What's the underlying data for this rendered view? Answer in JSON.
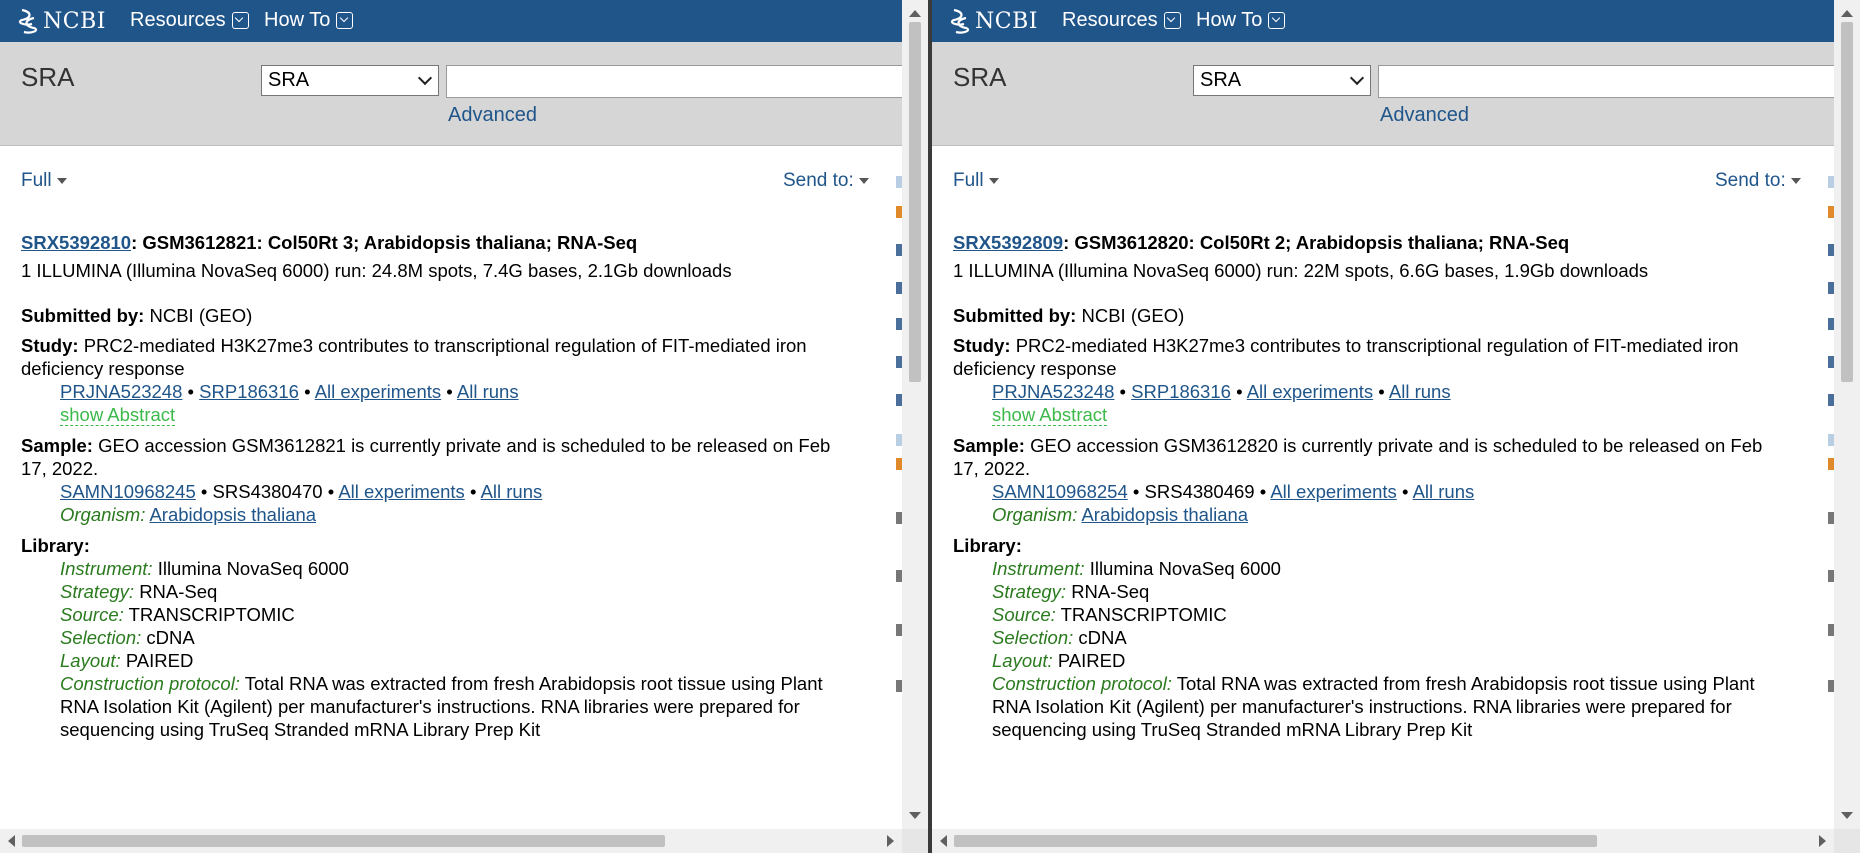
{
  "header": {
    "logo_text": "NCBI",
    "resources_label": "Resources",
    "howto_label": "How To"
  },
  "search": {
    "db_title": "SRA",
    "db_selected": "SRA",
    "input_value": "",
    "advanced_label": "Advanced"
  },
  "toolbar": {
    "format_label": "Full",
    "send_to_label": "Send to:"
  },
  "colors": {
    "header_bg": "#20558a",
    "search_bg": "#d6d6d6",
    "link": "#20558a",
    "field_label_green": "#2a7a1e",
    "show_abstract_green": "#3cb94a"
  },
  "records": [
    {
      "accession": "SRX5392810",
      "title_rest": ": GSM3612821: Col50Rt 3; Arabidopsis thaliana; RNA-Seq",
      "run_line": "1 ILLUMINA (Illumina NovaSeq 6000) run: 24.8M spots, 7.4G bases, 2.1Gb downloads",
      "submitted_label": "Submitted by:",
      "submitted_value": "NCBI (GEO)",
      "study_label": "Study:",
      "study_line1": "PRC2-mediated H3K27me3 contributes to transcriptional regulation of FIT-mediated iron",
      "study_line2": "deficiency response",
      "study_links": {
        "bioproject": "PRJNA523248",
        "srp": "SRP186316",
        "all_experiments": "All experiments",
        "all_runs": "All runs",
        "sep": "•"
      },
      "show_abstract": "show Abstract",
      "sample_label": "Sample:",
      "sample_line1": "GEO accession GSM3612821 is currently private and is scheduled to be released on Feb",
      "sample_line2": "17, 2022.",
      "sample_links": {
        "biosample": "SAMN10968245",
        "srs": "SRS4380470",
        "all_experiments": "All experiments",
        "all_runs": "All runs",
        "sep": "•"
      },
      "organism_label": "Organism:",
      "organism_value": "Arabidopsis thaliana",
      "library_label": "Library:",
      "instrument_label": "Instrument:",
      "instrument_value": "Illumina NovaSeq 6000",
      "strategy_label": "Strategy:",
      "strategy_value": "RNA-Seq",
      "source_label": "Source:",
      "source_value": "TRANSCRIPTOMIC",
      "selection_label": "Selection:",
      "selection_value": "cDNA",
      "layout_label": "Layout:",
      "layout_value": "PAIRED",
      "protocol_label": "Construction protocol:",
      "protocol_line1": "Total RNA was extracted from fresh Arabidopsis root tissue using Plant",
      "protocol_line2": "RNA Isolation Kit (Agilent) per manufacturer's instructions. RNA libraries were prepared for",
      "protocol_line3": "sequencing using TruSeq Stranded mRNA Library Prep Kit"
    },
    {
      "accession": "SRX5392809",
      "title_rest": ": GSM3612820: Col50Rt 2; Arabidopsis thaliana; RNA-Seq",
      "run_line": "1 ILLUMINA (Illumina NovaSeq 6000) run: 22M spots, 6.6G bases, 1.9Gb downloads",
      "submitted_label": "Submitted by:",
      "submitted_value": "NCBI (GEO)",
      "study_label": "Study:",
      "study_line1": "PRC2-mediated H3K27me3 contributes to transcriptional regulation of FIT-mediated iron",
      "study_line2": "deficiency response",
      "study_links": {
        "bioproject": "PRJNA523248",
        "srp": "SRP186316",
        "all_experiments": "All experiments",
        "all_runs": "All runs",
        "sep": "•"
      },
      "show_abstract": "show Abstract",
      "sample_label": "Sample:",
      "sample_line1": "GEO accession GSM3612820 is currently private and is scheduled to be released on Feb",
      "sample_line2": "17, 2022.",
      "sample_links": {
        "biosample": "SAMN10968254",
        "srs": "SRS4380469",
        "all_experiments": "All experiments",
        "all_runs": "All runs",
        "sep": "•"
      },
      "organism_label": "Organism:",
      "organism_value": "Arabidopsis thaliana",
      "library_label": "Library:",
      "instrument_label": "Instrument:",
      "instrument_value": "Illumina NovaSeq 6000",
      "strategy_label": "Strategy:",
      "strategy_value": "RNA-Seq",
      "source_label": "Source:",
      "source_value": "TRANSCRIPTOMIC",
      "selection_label": "Selection:",
      "selection_value": "cDNA",
      "layout_label": "Layout:",
      "layout_value": "PAIRED",
      "protocol_label": "Construction protocol:",
      "protocol_line1": "Total RNA was extracted from fresh Arabidopsis root tissue using Plant",
      "protocol_line2": "RNA Isolation Kit (Agilent) per manufacturer's instructions. RNA libraries were prepared for",
      "protocol_line3": "sequencing using TruSeq Stranded mRNA Library Prep Kit"
    }
  ]
}
